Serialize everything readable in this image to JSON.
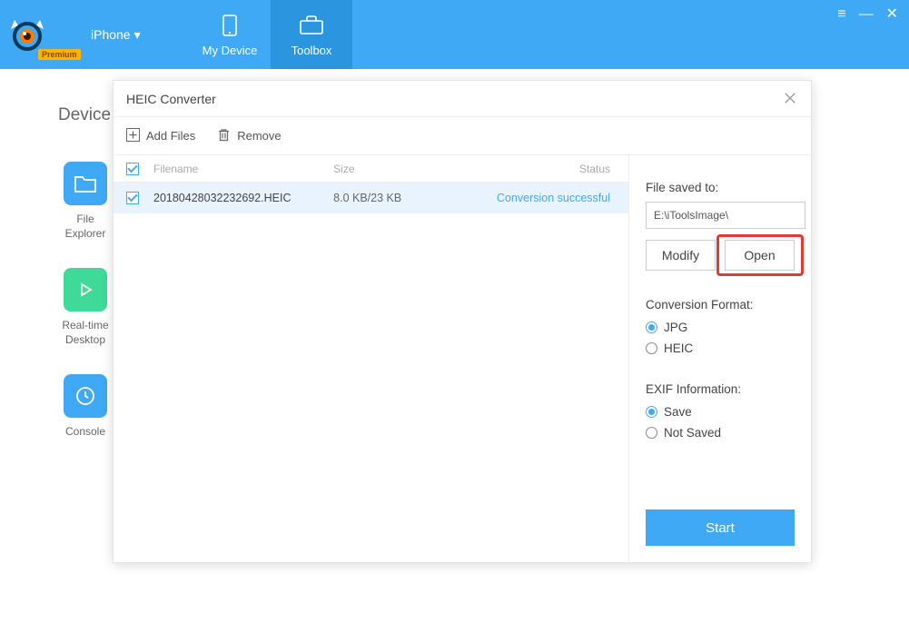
{
  "header": {
    "premium_badge": "Premium",
    "device_label": "iPhone",
    "tabs": {
      "my_device": "My Device",
      "toolbox": "Toolbox"
    }
  },
  "bg": {
    "title": "Device",
    "items": {
      "file_explorer": "File\nExplorer",
      "realtime": "Real-time\nDesktop",
      "console": "Console"
    }
  },
  "modal": {
    "title": "HEIC Converter",
    "toolbar": {
      "add_files": "Add Files",
      "remove": "Remove"
    },
    "columns": {
      "filename": "Filename",
      "size": "Size",
      "status": "Status"
    },
    "rows": [
      {
        "filename": "20180428032232692.HEIC",
        "size": "8.0 KB/23 KB",
        "status": "Conversion successful"
      }
    ],
    "side": {
      "saved_to_label": "File saved to:",
      "saved_to_value": "E:\\iToolsImage\\",
      "modify": "Modify",
      "open": "Open",
      "format_label": "Conversion Format:",
      "format_jpg": "JPG",
      "format_heic": "HEIC",
      "exif_label": "EXIF Information:",
      "exif_save": "Save",
      "exif_not_saved": "Not Saved",
      "start": "Start"
    }
  }
}
